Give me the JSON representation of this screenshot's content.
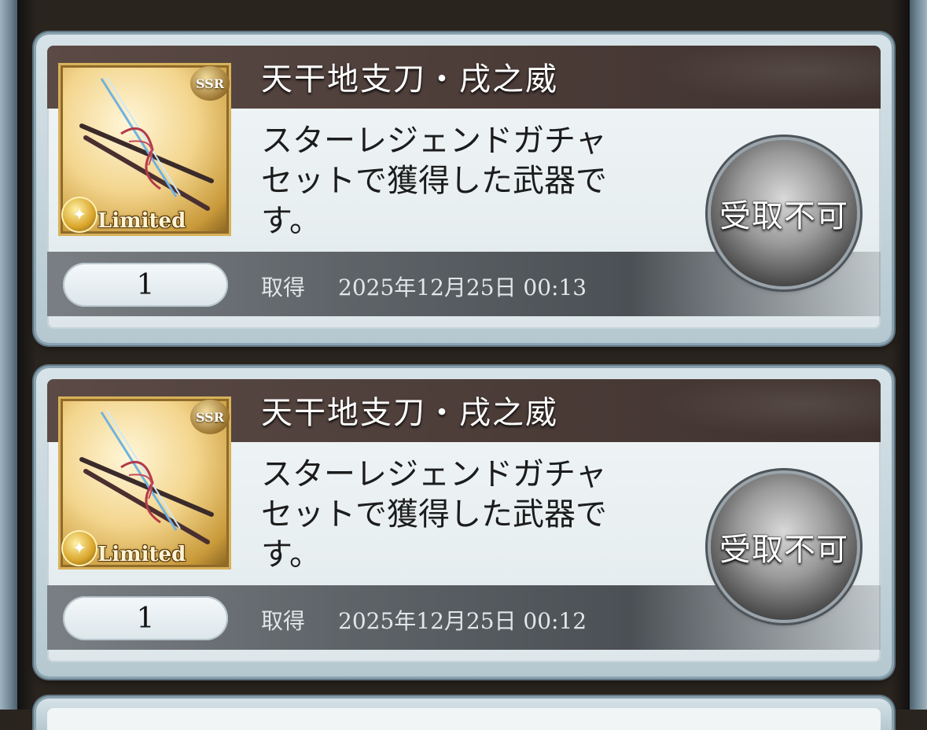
{
  "items": [
    {
      "name": "天干地支刀・戌之威",
      "rarity": "SSR",
      "tag": "Limited",
      "description": [
        "スターレジェンドガチャ",
        "セットで獲得した武器で",
        "す。"
      ],
      "quantity": "1",
      "acquired_label": "取得",
      "acquired_date": "2025年12月25日 00:13",
      "button_label": "受取不可"
    },
    {
      "name": "天干地支刀・戌之威",
      "rarity": "SSR",
      "tag": "Limited",
      "description": [
        "スターレジェンドガチャ",
        "セットで獲得した武器で",
        "す。"
      ],
      "quantity": "1",
      "acquired_label": "取得",
      "acquired_date": "2025年12月25日 00:12",
      "button_label": "受取不可"
    }
  ]
}
